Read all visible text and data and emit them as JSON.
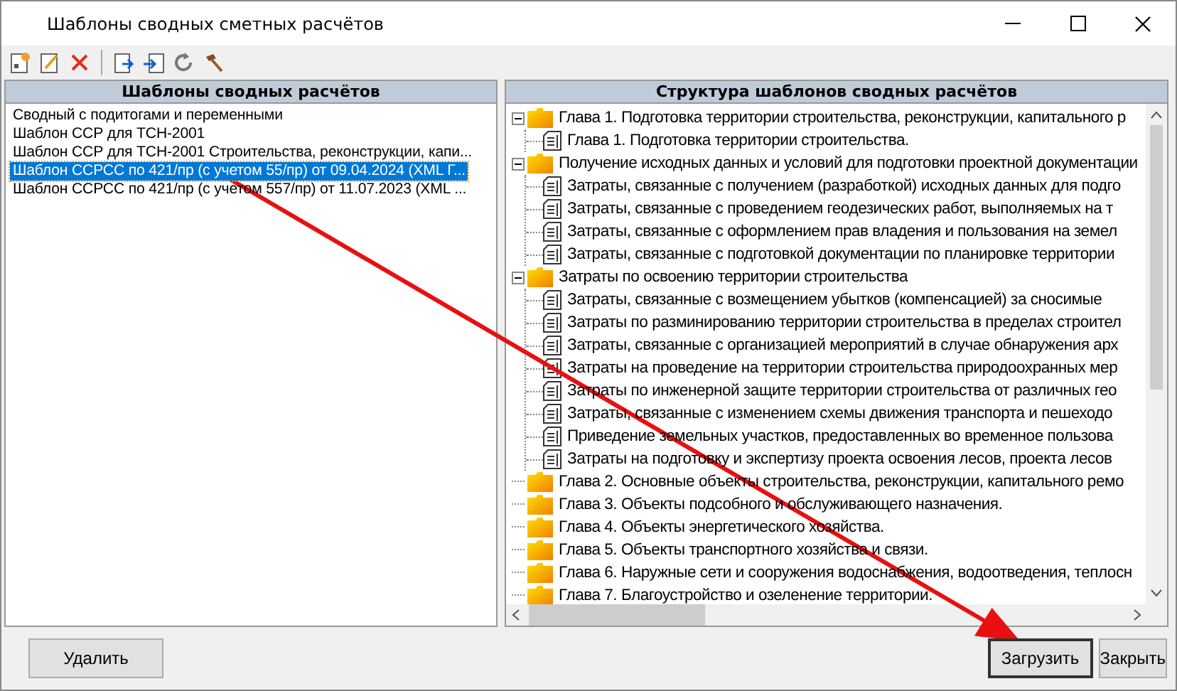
{
  "window": {
    "title": "Шаблоны сводных сметных расчётов"
  },
  "templates_panel": {
    "header": "Шаблоны сводных расчётов",
    "items": [
      {
        "label": "Сводный с подитогами и переменными",
        "selected": false
      },
      {
        "label": "Шаблон ССР для ТСН-2001",
        "selected": false
      },
      {
        "label": "Шаблон ССР для ТСН-2001 Строительства, реконструкции, капи...",
        "selected": false
      },
      {
        "label": "Шаблон ССРСС по 421/пр (с учетом 55/пр) от 09.04.2024 (XML Г...",
        "selected": true
      },
      {
        "label": "Шаблон ССРСС по 421/пр (с учетом 557/пр) от 11.07.2023 (XML ...",
        "selected": false
      }
    ]
  },
  "structure_panel": {
    "header": "Структура шаблонов сводных расчётов",
    "tree": [
      {
        "kind": "folder",
        "label": "Глава  1. Подготовка территории строительства, реконструкции, капитального р",
        "expanded": true,
        "children": [
          {
            "kind": "page",
            "label": "Глава  1. Подготовка территории строительства."
          }
        ]
      },
      {
        "kind": "folder",
        "label": "Получение исходных данных и условий для подготовки проектной документации",
        "expanded": true,
        "children": [
          {
            "kind": "page",
            "label": "Затраты, связанные с получением (разработкой) исходных данных для подго"
          },
          {
            "kind": "page",
            "label": "Затраты, связанные с проведением геодезических работ, выполняемых на т"
          },
          {
            "kind": "page",
            "label": "Затраты, связанные с оформлением прав владения и пользования на земел"
          },
          {
            "kind": "page",
            "label": "Затраты, связанные с подготовкой документации по планировке территории"
          }
        ]
      },
      {
        "kind": "folder",
        "label": "Затраты по освоению территории строительства",
        "expanded": true,
        "children": [
          {
            "kind": "page",
            "label": "Затраты, связанные с возмещением убытков (компенсацией) за сносимые"
          },
          {
            "kind": "page",
            "label": "Затраты по разминированию территории строительства в пределах строител"
          },
          {
            "kind": "page",
            "label": "Затраты, связанные с организацией мероприятий в случае обнаружения арх"
          },
          {
            "kind": "page",
            "label": "Затраты на проведение на территории строительства природоохранных мер"
          },
          {
            "kind": "page",
            "label": "Затраты по инженерной защите территории строительства от различных гео"
          },
          {
            "kind": "page",
            "label": "Затраты, связанные с изменением схемы движения транспорта и пешеходо"
          },
          {
            "kind": "page",
            "label": "Приведение земельных участков, предоставленных во временное пользова"
          },
          {
            "kind": "page",
            "label": "Затраты на подготовку и экспертизу проекта освоения лесов, проекта лесов"
          }
        ]
      },
      {
        "kind": "folder",
        "label": "Глава  2. Основные объекты строительства, реконструкции, капитального ремо"
      },
      {
        "kind": "folder",
        "label": "Глава  3. Объекты подсобного и обслуживающего назначения."
      },
      {
        "kind": "folder",
        "label": "Глава  4. Объекты энергетического хозяйства."
      },
      {
        "kind": "folder",
        "label": "Глава  5. Объекты транспортного хозяйства и связи."
      },
      {
        "kind": "folder",
        "label": "Глава  6. Наружные сети и сооружения водоснабжения, водоотведения, теплосн"
      },
      {
        "kind": "folder",
        "label": "Глава  7. Благоустройство и озеленение территории."
      }
    ]
  },
  "left_buttons": [
    {
      "label": "Удалить",
      "default": false
    }
  ],
  "right_buttons": [
    {
      "label": "Загрузить",
      "default": true
    },
    {
      "label": "Закрыть",
      "default": false
    }
  ]
}
